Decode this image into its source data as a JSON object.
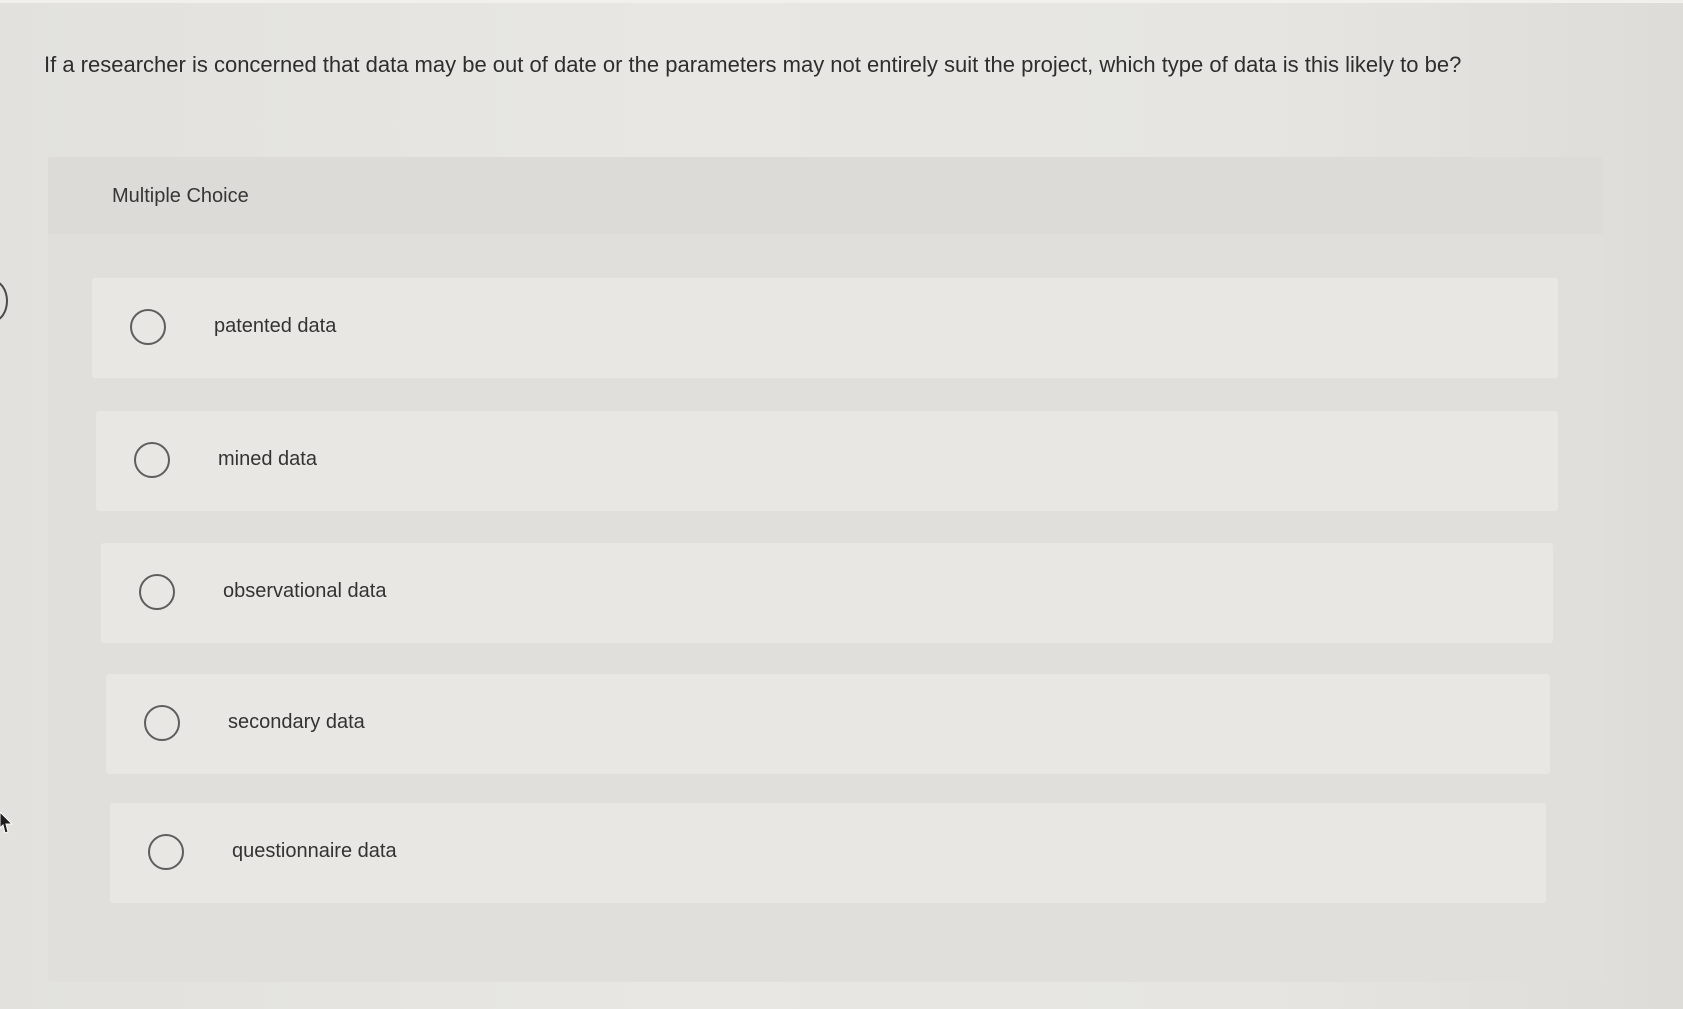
{
  "question": {
    "text": "If a researcher is concerned that data may be out of date or the parameters may not entirely suit the project, which type of data is this likely to be?"
  },
  "multiple_choice": {
    "title": "Multiple Choice",
    "options": [
      {
        "label": "patented data",
        "selected": false
      },
      {
        "label": "mined data",
        "selected": false
      },
      {
        "label": "observational data",
        "selected": false
      },
      {
        "label": "secondary data",
        "selected": false
      },
      {
        "label": "questionnaire data",
        "selected": false
      }
    ]
  },
  "icons": {
    "radio": "radio-unchecked-icon",
    "pointer": "mouse-pointer-icon"
  },
  "colors": {
    "background": "#e6e5e1",
    "panel": "#e0dfdb",
    "option_card": "#e8e7e3",
    "text": "#2f2f2f",
    "radio_border": "#5e5e5e"
  }
}
